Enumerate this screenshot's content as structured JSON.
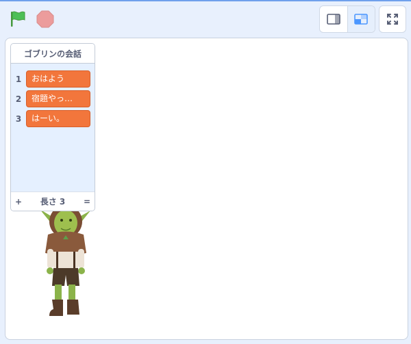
{
  "controls": {
    "green_flag_icon": "green-flag-icon",
    "stop_icon": "stop-icon",
    "small_stage_icon": "small-stage-icon",
    "large_stage_icon": "large-stage-icon",
    "fullscreen_icon": "fullscreen-icon",
    "large_stage_active": true
  },
  "list_monitor": {
    "title": "ゴブリンの会話",
    "items": [
      {
        "index": "1",
        "value": "おはよう"
      },
      {
        "index": "2",
        "value": "宿題やっ…"
      },
      {
        "index": "3",
        "value": "はーい。"
      }
    ],
    "footer": {
      "add_label": "+",
      "length_label": "長さ 3",
      "resize_label": "="
    }
  },
  "colors": {
    "flag_green": "#4cbf56",
    "stop_red": "#ec9c9c",
    "list_item_orange": "#f2763c",
    "active_mode_blue": "#4c97ff",
    "text_gray": "#575e75"
  }
}
